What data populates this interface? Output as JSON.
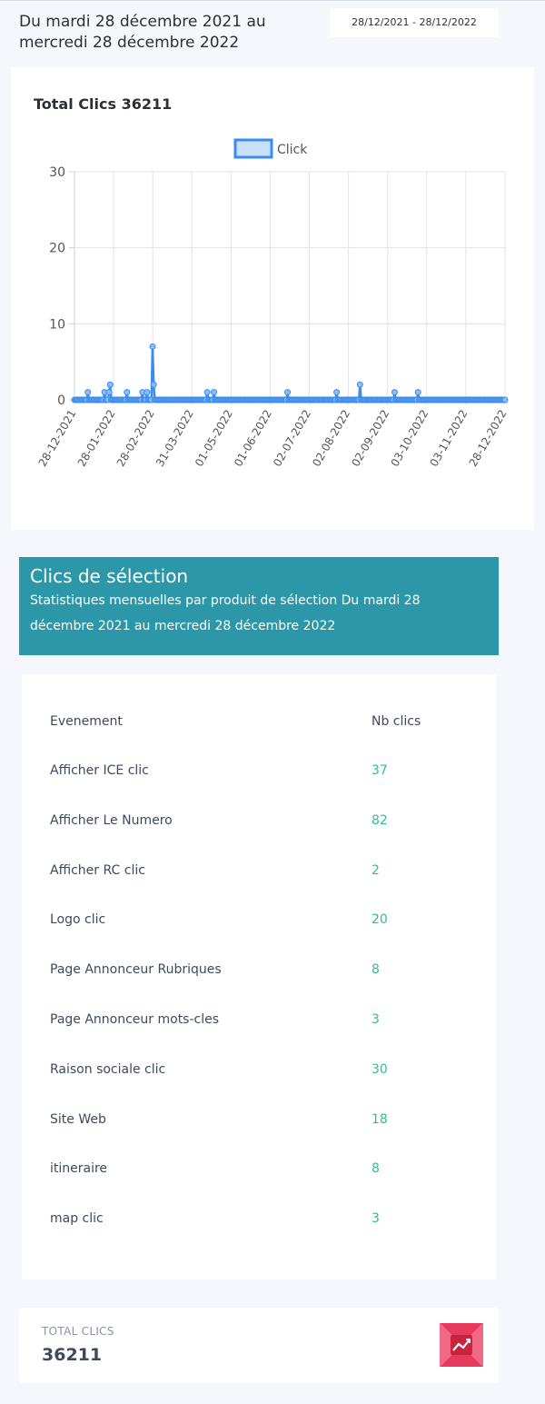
{
  "header": {
    "period_title": "Du mardi 28 décembre 2021 au mercredi 28 décembre 2022",
    "date_range": "28/12/2021 - 28/12/2022"
  },
  "chart": {
    "title": "Total Clics 36211"
  },
  "chart_data": {
    "type": "line",
    "title": "Total Clics 36211",
    "xlabel": "",
    "ylabel": "",
    "ylim": [
      0,
      30
    ],
    "y_ticks": [
      0,
      10,
      20,
      30
    ],
    "x_tick_labels": [
      "28-12-2021",
      "28-01-2022",
      "28-02-2022",
      "31-03-2022",
      "01-05-2022",
      "01-06-2022",
      "02-07-2022",
      "02-08-2022",
      "02-09-2022",
      "03-10-2022",
      "03-11-2022",
      "28-12-2022"
    ],
    "grid": true,
    "legend_position": "top",
    "series": [
      {
        "name": "Click",
        "color": "#3b8cf0",
        "fill": "#c9e0fb",
        "values": [
          0,
          0,
          0,
          0,
          0,
          0,
          0,
          0,
          0,
          0,
          0,
          0,
          1,
          0,
          0,
          0,
          0,
          0,
          0,
          0,
          0,
          0,
          0,
          0,
          0,
          0,
          0,
          1,
          0,
          0,
          0,
          1,
          2,
          0,
          0,
          0,
          0,
          0,
          0,
          0,
          0,
          0,
          0,
          0,
          0,
          0,
          0,
          1,
          0,
          0,
          0,
          0,
          0,
          0,
          0,
          0,
          0,
          0,
          0,
          0,
          0,
          1,
          0,
          0,
          0,
          1,
          0,
          0,
          0,
          0,
          7,
          2,
          0,
          0,
          0,
          0,
          0,
          0,
          0,
          0,
          0,
          0,
          0,
          0,
          0,
          0,
          0,
          0,
          0,
          0,
          0,
          0,
          0,
          0,
          0,
          0,
          0,
          0,
          0,
          0,
          0,
          0,
          0,
          0,
          0,
          0,
          0,
          0,
          0,
          0,
          0,
          0,
          0,
          0,
          0,
          0,
          0,
          0,
          0,
          1,
          0,
          0,
          0,
          0,
          0,
          1,
          0,
          0,
          0,
          0,
          0,
          0,
          0,
          0,
          0,
          0,
          0,
          0,
          0,
          0,
          0,
          0,
          0,
          0,
          0,
          0,
          0,
          0,
          0,
          0,
          0,
          0,
          0,
          0,
          0,
          0,
          0,
          0,
          0,
          0,
          0,
          0,
          0,
          0,
          0,
          0,
          0,
          0,
          0,
          0,
          0,
          0,
          0,
          0,
          0,
          0,
          0,
          0,
          0,
          0,
          0,
          0,
          0,
          0,
          0,
          0,
          0,
          0,
          0,
          0,
          0,
          1,
          0,
          0,
          0,
          0,
          0,
          0,
          0,
          0,
          0,
          0,
          0,
          0,
          0,
          0,
          0,
          0,
          0,
          0,
          0,
          0,
          0,
          0,
          0,
          0,
          0,
          0,
          0,
          0,
          0,
          0,
          0,
          0,
          0,
          0,
          0,
          0,
          0,
          0,
          0,
          0,
          0,
          0,
          0,
          1,
          0,
          0,
          0,
          0,
          0,
          0,
          0,
          0,
          0,
          0,
          0,
          0,
          0,
          0,
          0,
          0,
          0,
          0,
          0,
          0,
          2,
          0,
          0,
          0,
          0,
          0,
          0,
          0,
          0,
          0,
          0,
          0,
          0,
          0,
          0,
          0,
          0,
          0,
          0,
          0,
          0,
          0,
          0,
          0,
          0,
          0,
          0,
          0,
          0,
          0,
          0,
          1,
          0,
          0,
          0,
          0,
          0,
          0,
          0,
          0,
          0,
          0,
          0,
          0,
          0,
          0,
          0,
          0,
          0,
          0,
          0,
          0,
          1,
          0,
          0,
          0,
          0,
          0,
          0,
          0,
          0,
          0,
          0,
          0,
          0,
          0,
          0,
          0,
          0,
          0,
          0,
          0,
          0,
          0,
          0,
          0,
          0,
          0,
          0,
          0,
          0,
          0,
          0,
          0,
          0,
          0,
          0,
          0,
          0,
          0,
          0,
          0,
          0,
          0,
          0,
          0,
          0,
          0,
          0,
          0,
          0,
          0,
          0,
          0,
          0,
          0,
          0,
          0,
          0,
          0,
          0,
          0,
          0,
          0,
          0,
          0,
          0,
          0,
          0,
          0,
          0,
          0,
          0,
          0,
          0,
          0,
          0,
          0,
          0,
          0,
          0
        ]
      }
    ]
  },
  "selection": {
    "title": "Clics de sélection",
    "subtitle": "Statistiques mensuelles par produit de sélection Du mardi 28 décembre 2021 au mercredi 28 décembre 2022",
    "col_event": "Evenement",
    "col_clicks": "Nb clics",
    "rows": [
      {
        "event": "Afficher ICE clic",
        "clicks": "37"
      },
      {
        "event": "Afficher Le Numero",
        "clicks": "82"
      },
      {
        "event": "Afficher RC clic",
        "clicks": "2"
      },
      {
        "event": "Logo clic",
        "clicks": "20"
      },
      {
        "event": "Page Annonceur Rubriques",
        "clicks": "8"
      },
      {
        "event": "Page Annonceur mots-cles",
        "clicks": "3"
      },
      {
        "event": "Raison sociale clic",
        "clicks": "30"
      },
      {
        "event": "Site Web",
        "clicks": "18"
      },
      {
        "event": "itineraire",
        "clicks": "8"
      },
      {
        "event": "map clic",
        "clicks": "3"
      }
    ]
  },
  "total": {
    "label": "TOTAL CLICS",
    "value": "36211",
    "icon": "trending-chart-icon"
  }
}
